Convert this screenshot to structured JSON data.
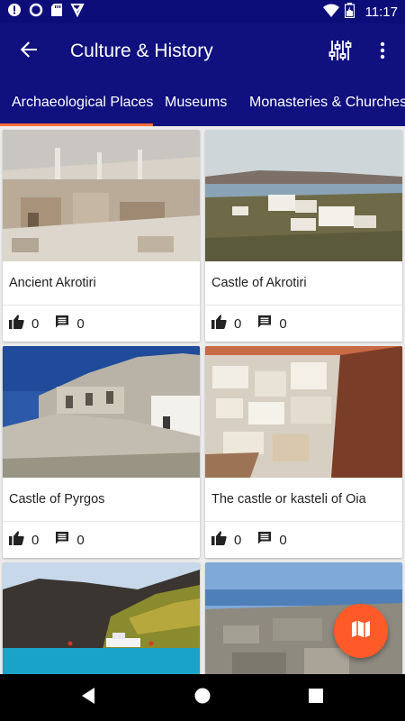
{
  "status_bar": {
    "time": "11:17",
    "icons": [
      "alert-icon",
      "circle-icon",
      "sd-card-icon",
      "checkmark-download-icon",
      "wifi-icon",
      "battery-icon"
    ]
  },
  "app_bar": {
    "title": "Culture & History",
    "icons": [
      "back-arrow-icon",
      "filter-sliders-icon",
      "more-vert-icon"
    ]
  },
  "tabs": [
    {
      "label": "Archaeological Places",
      "active": true
    },
    {
      "label": "Museums",
      "active": false
    },
    {
      "label": "Monasteries & Churches",
      "active": false
    }
  ],
  "cards": [
    {
      "title": "Ancient Akrotiri",
      "likes": "0",
      "comments": "0"
    },
    {
      "title": "Castle of Akrotiri",
      "likes": "0",
      "comments": "0"
    },
    {
      "title": "Castle of Pyrgos",
      "likes": "0",
      "comments": "0"
    },
    {
      "title": "The castle or kasteli of Oia",
      "likes": "0",
      "comments": "0"
    },
    {
      "title": "",
      "likes": "",
      "comments": ""
    },
    {
      "title": "",
      "likes": "",
      "comments": ""
    }
  ],
  "fab": {
    "icon": "map-icon"
  },
  "colors": {
    "primary": "#10107f",
    "status_bar": "#0d0d7a",
    "accent": "#ff5a27",
    "tab_indicator": "#ff6d3a"
  }
}
